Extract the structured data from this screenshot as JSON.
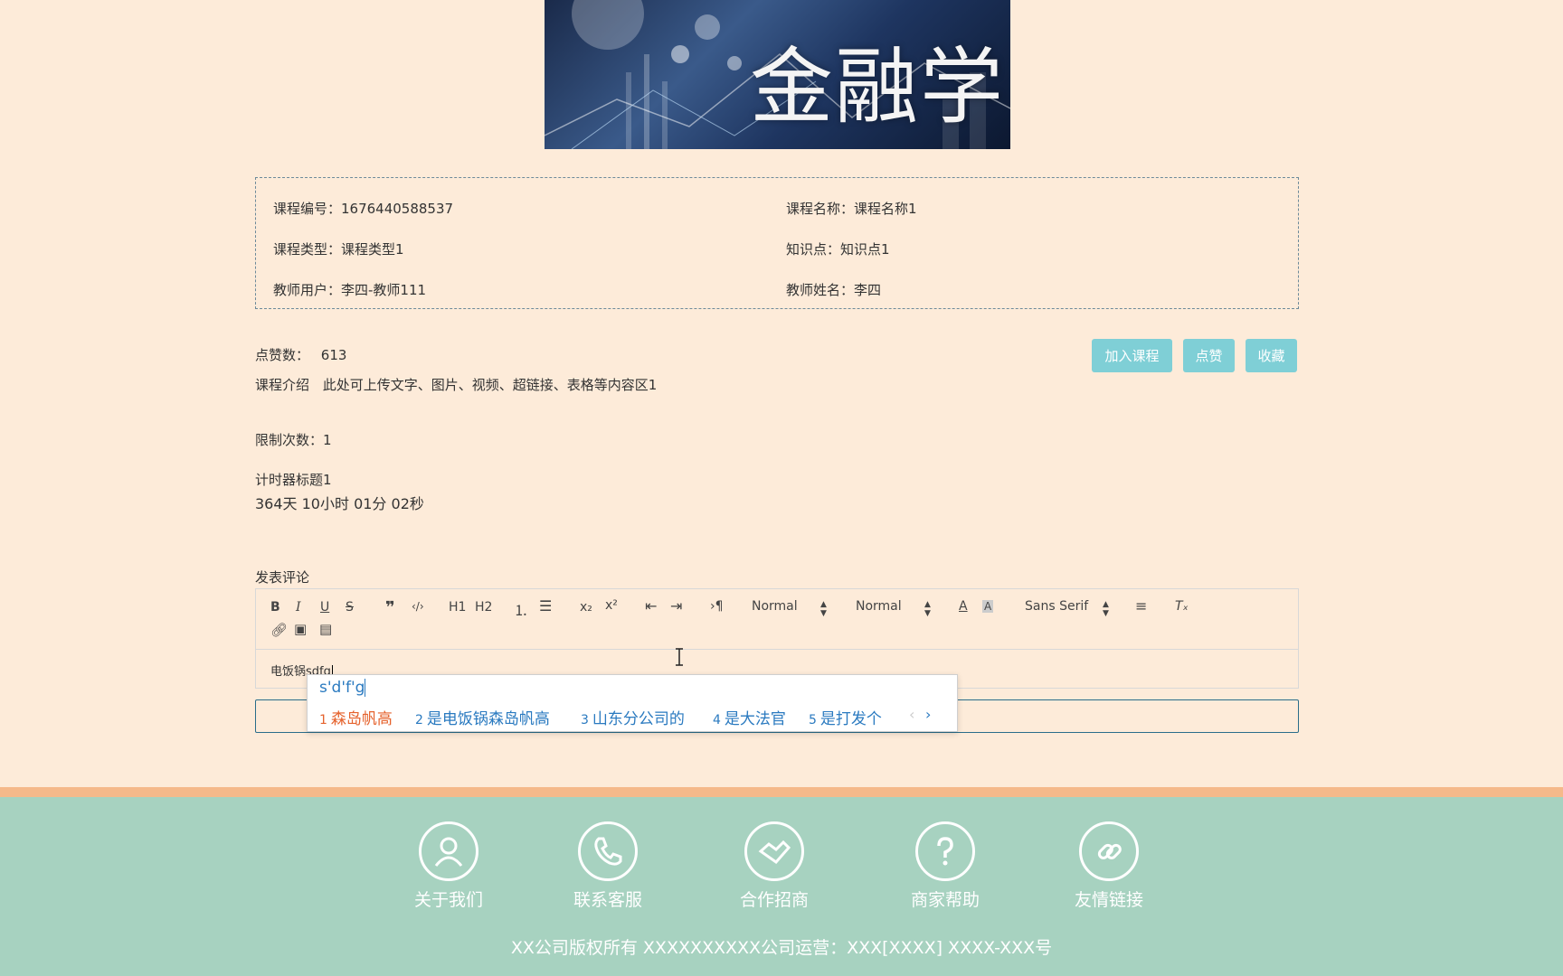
{
  "banner": {
    "title": "金融学"
  },
  "course_info": {
    "course_no": "课程编号：1676440588537",
    "course_name": "课程名称：课程名称1",
    "course_type": "课程类型：课程类型1",
    "knowledge": "知识点：知识点1",
    "teacher_user": "教师用户：李四-教师111",
    "teacher_name": "教师姓名：李四"
  },
  "stats": {
    "likes_label": "点赞数：",
    "likes_value": "613",
    "intro_label": "课程介绍",
    "intro_value": "此处可上传文字、图片、视频、超链接、表格等内容区1",
    "limit": "限制次数：1",
    "timer_title": "计时器标题1",
    "timer_value": "364天 10小时 01分 02秒"
  },
  "actions": {
    "join": "加入课程",
    "like": "点赞",
    "favorite": "收藏"
  },
  "comment": {
    "label": "发表评论",
    "editor_text": "电饭锅sdfg",
    "toolbar": {
      "header_select": "Normal",
      "size_select": "Normal",
      "font_select": "Sans Serif",
      "h1": "H1",
      "h2": "H2"
    }
  },
  "ime": {
    "input": "s'd'f'g",
    "candidates": [
      {
        "num": "1",
        "text": "森岛帆高"
      },
      {
        "num": "2",
        "text": "是电饭锅森岛帆高"
      },
      {
        "num": "3",
        "text": "山东分公司的"
      },
      {
        "num": "4",
        "text": "是大法官"
      },
      {
        "num": "5",
        "text": "是打发个"
      }
    ],
    "prev": "‹",
    "next": "›"
  },
  "footer": {
    "links": [
      {
        "label": "关于我们",
        "icon": "user-icon"
      },
      {
        "label": "联系客服",
        "icon": "phone-icon"
      },
      {
        "label": "合作招商",
        "icon": "handshake-icon"
      },
      {
        "label": "商家帮助",
        "icon": "question-icon"
      },
      {
        "label": "友情链接",
        "icon": "link-icon"
      }
    ],
    "copyright": "XX公司版权所有 XXXXXXXXXX公司运营：XXX[XXXX] XXXX-XXX号"
  },
  "colors": {
    "page_bg": "#fdebd9",
    "button": "#7fcfd6",
    "footer_bg": "#a7d2c0",
    "footer_stripe": "#f5b98a",
    "ime_highlight": "#e5622c",
    "ime_text": "#2a7ac0"
  }
}
